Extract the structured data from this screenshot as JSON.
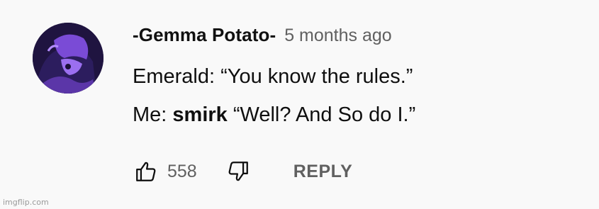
{
  "comment": {
    "author": "-Gemma Potato-",
    "timestamp": "5 months ago",
    "line1": "Emerald: “You know the rules.”",
    "line2_prefix": "Me: ",
    "line2_bold": "smirk",
    "line2_suffix": " “Well? And So do I.”",
    "avatar_icon": "profile-avatar-image",
    "avatar_colors": {
      "dark": "#1f1440",
      "accent": "#7a4bd6"
    }
  },
  "actions": {
    "like_icon": "thumbs-up-icon",
    "like_count": "558",
    "dislike_icon": "thumbs-down-icon",
    "reply_label": "REPLY"
  },
  "watermark": "imgflip.com"
}
